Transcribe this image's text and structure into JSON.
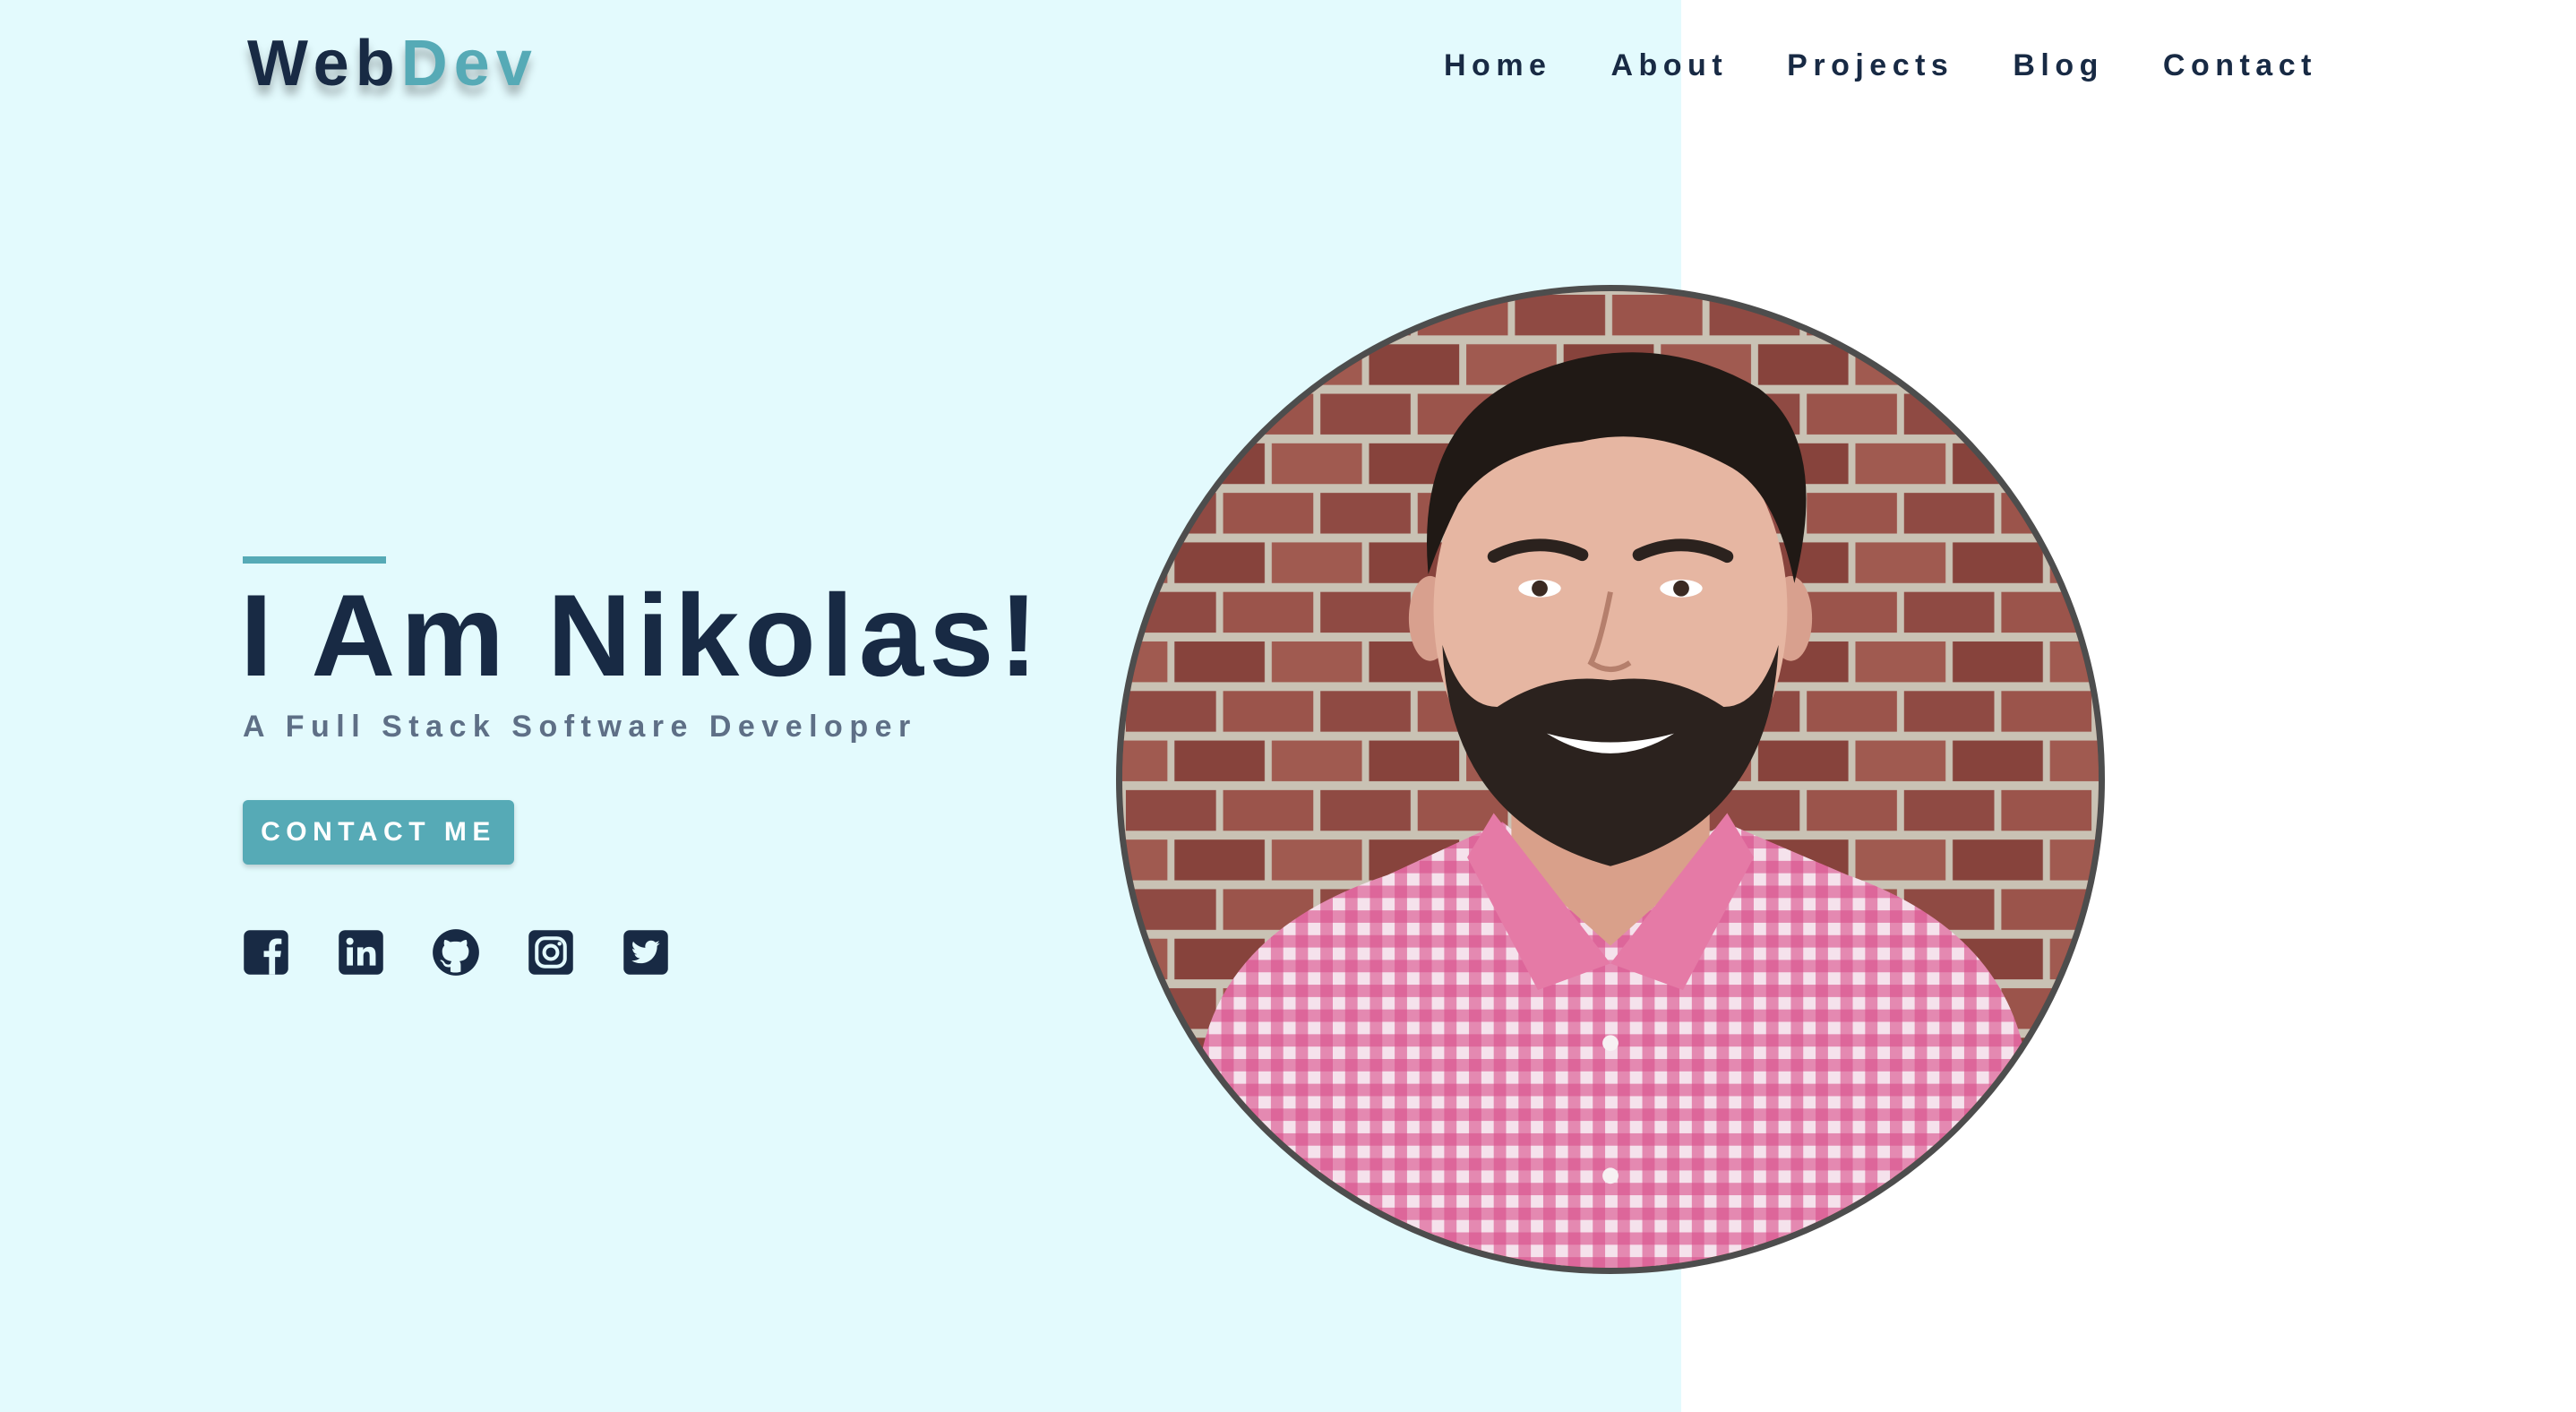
{
  "header": {
    "logo_part1": "Web",
    "logo_part2": "Dev",
    "nav": [
      {
        "label": "Home"
      },
      {
        "label": "About"
      },
      {
        "label": "Projects"
      },
      {
        "label": "Blog"
      },
      {
        "label": "Contact"
      }
    ]
  },
  "hero": {
    "title": "I Am Nikolas!",
    "subtitle": "A Full Stack Software Developer",
    "cta_label": "CONTACT ME",
    "socials": [
      {
        "icon": "facebook-icon"
      },
      {
        "icon": "linkedin-icon"
      },
      {
        "icon": "github-icon"
      },
      {
        "icon": "instagram-icon"
      },
      {
        "icon": "twitter-icon"
      }
    ]
  },
  "colors": {
    "accent": "#56aab6",
    "navy": "#182a44",
    "hero_bg": "#e3fafd",
    "subtitle": "#5e6f86"
  }
}
